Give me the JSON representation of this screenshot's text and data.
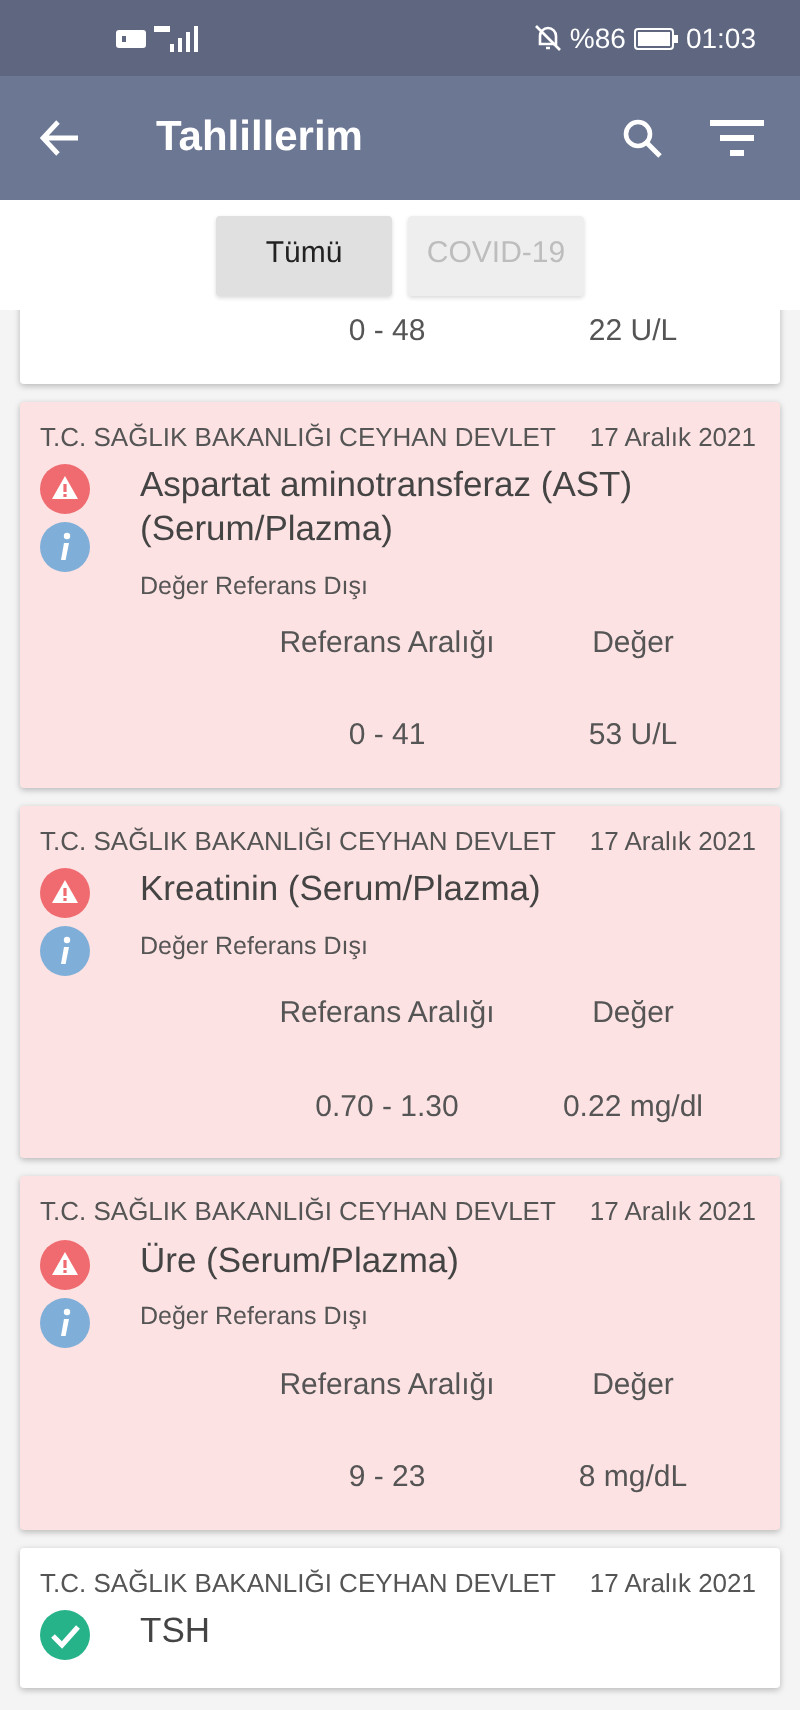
{
  "status_bar": {
    "battery_text": "%86",
    "time": "01:03"
  },
  "app_bar": {
    "title": "Tahlillerim"
  },
  "tabs": [
    {
      "label": "Tümü",
      "selected": true
    },
    {
      "label": "COVID-19",
      "selected": false
    }
  ],
  "results": [
    {
      "kind": "normal",
      "range": "0 - 48",
      "value": "22 U/L"
    },
    {
      "kind": "abnormal",
      "institution": "T.C. SAĞLIK BAKANLIĞI CEYHAN DEVLET",
      "date": "17 Aralık 2021",
      "name": "Aspartat aminotransferaz (AST) (Serum/Plazma)",
      "status": "Değer Referans Dışı",
      "range_header": "Referans Aralığı",
      "value_header": "Değer",
      "range": "0 - 41",
      "value": "53 U/L"
    },
    {
      "kind": "abnormal",
      "institution": "T.C. SAĞLIK BAKANLIĞI CEYHAN DEVLET",
      "date": "17 Aralık 2021",
      "name": "Kreatinin (Serum/Plazma)",
      "status": "Değer Referans Dışı",
      "range_header": "Referans Aralığı",
      "value_header": "Değer",
      "range": "0.70 - 1.30",
      "value": "0.22 mg/dl"
    },
    {
      "kind": "abnormal",
      "institution": "T.C. SAĞLIK BAKANLIĞI CEYHAN DEVLET",
      "date": "17 Aralık 2021",
      "name": "Üre (Serum/Plazma)",
      "status": "Değer Referans Dışı",
      "range_header": "Referans Aralığı",
      "value_header": "Değer",
      "range": "9 - 23",
      "value": "8 mg/dL"
    },
    {
      "kind": "normal",
      "institution": "T.C. SAĞLIK BAKANLIĞI CEYHAN DEVLET",
      "date": "17 Aralık 2021",
      "name": "TSH"
    }
  ]
}
